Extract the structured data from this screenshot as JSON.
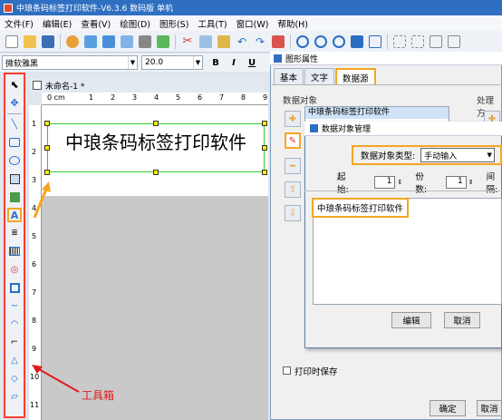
{
  "app_title": "中琅条码标签打印软件-V6.3.6 数码版 单机",
  "menu": [
    "文件(F)",
    "编辑(E)",
    "查看(V)",
    "绘图(D)",
    "图形(S)",
    "工具(T)",
    "窗口(W)",
    "帮助(H)"
  ],
  "font": {
    "family": "微软雅黑",
    "size": "20.0"
  },
  "format_buttons": [
    "B",
    "I",
    "U"
  ],
  "document_tab": "未命名-1 *",
  "ruler": {
    "h_label": "0 cm",
    "h_ticks": [
      "1",
      "2",
      "3",
      "4",
      "5",
      "6",
      "7",
      "8",
      "9"
    ],
    "v_ticks": [
      "1",
      "2",
      "3",
      "4",
      "5",
      "6",
      "7",
      "8",
      "9",
      "10",
      "11"
    ]
  },
  "label_text": "中琅条码标签打印软件",
  "toolbox_label": "工具箱",
  "properties": {
    "title": "图形属性",
    "tabs": [
      "基本",
      "文字",
      "数据源"
    ],
    "data_objects_label": "数据对象",
    "processing_label": "处理方",
    "list_items": [
      "中琅条码标签打印软件"
    ],
    "print_save_label": "打印时保存",
    "ok_label": "确定",
    "cancel_label": "取消"
  },
  "data_dialog": {
    "title": "数据对象管理",
    "type_label": "数据对象类型:",
    "type_value": "手动输入",
    "start_label": "起始:",
    "start_value": "1",
    "copies_label": "份数:",
    "copies_value": "1",
    "interval_label": "间隔:",
    "content": "中琅条码标签打印软件",
    "edit_label": "编辑",
    "cancel_label": "取消"
  }
}
